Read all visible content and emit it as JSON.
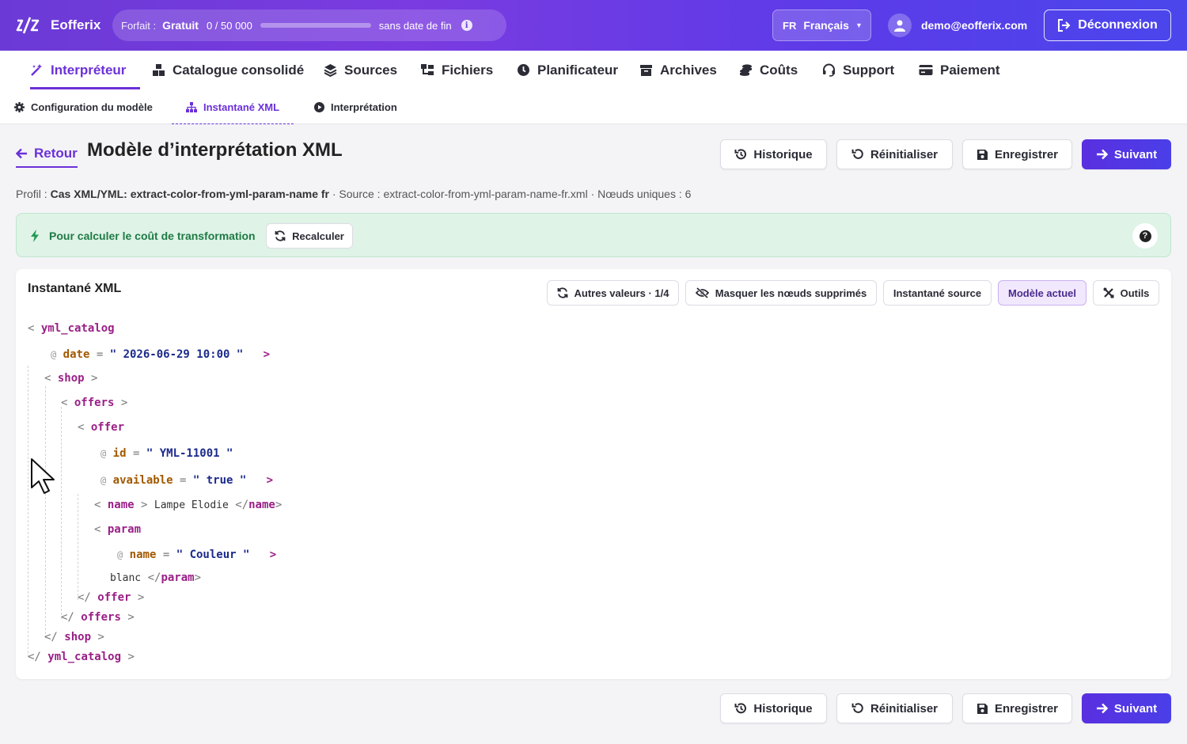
{
  "app": {
    "name": "Eofferix"
  },
  "plan": {
    "label": "Forfait :",
    "tier": "Gratuit",
    "quota": "0  /  50 000",
    "usage_fraction": 0.0,
    "end": "sans date de fin"
  },
  "lang": {
    "code": "FR",
    "name": "Français"
  },
  "user": {
    "email": "demo@eofferix.com"
  },
  "logout_label": "Déconnexion",
  "nav": [
    {
      "label": "Interpréteur",
      "icon": "magic-wand-icon",
      "active": true
    },
    {
      "label": "Catalogue consolidé",
      "icon": "boxes-icon"
    },
    {
      "label": "Sources",
      "icon": "layers-icon"
    },
    {
      "label": "Fichiers",
      "icon": "sitemap-icon"
    },
    {
      "label": "Planificateur",
      "icon": "clock-icon"
    },
    {
      "label": "Archives",
      "icon": "archive-icon"
    },
    {
      "label": "Coûts",
      "icon": "coins-icon"
    },
    {
      "label": "Support",
      "icon": "headset-icon"
    },
    {
      "label": "Paiement",
      "icon": "credit-card-icon"
    }
  ],
  "subnav": [
    {
      "label": "Configuration du modèle",
      "icon": "gear-icon"
    },
    {
      "label": "Instantané XML",
      "icon": "sitemap-icon",
      "active": true
    },
    {
      "label": "Interprétation",
      "icon": "play-circle-icon"
    }
  ],
  "page": {
    "back_label": "Retour",
    "title": "Modèle d’interprétation XML",
    "actions": {
      "history": "Historique",
      "reset": "Réinitialiser",
      "save": "Enregistrer",
      "next": "Suivant"
    }
  },
  "meta": {
    "profile_label": "Profil :",
    "profile": "Cas XML/YML: extract-color-from-yml-param-name fr",
    "source_text": "· Source : extract-color-from-yml-param-name-fr.xml · Nœuds uniques : 6"
  },
  "alert": {
    "text": "Pour calculer le coût de transformation",
    "recalc": "Recalculer",
    "help": "?"
  },
  "snapshot": {
    "title": "Instantané XML",
    "tools": {
      "other_values": "Autres valeurs · 1/4",
      "hide_deleted": "Masquer les nœuds supprimés",
      "source_snapshot": "Instantané source",
      "current_model": "Modèle actuel",
      "tools": "Outils"
    }
  },
  "xml": {
    "root": "yml_catalog",
    "root_attr": {
      "name": "date",
      "value": "2026-06-29 10:00"
    },
    "shop": "shop",
    "offers": "offers",
    "offer": "offer",
    "offer_attrs": [
      {
        "name": "id",
        "value": "YML-11001"
      },
      {
        "name": "available",
        "value": "true"
      }
    ],
    "name_tag": "name",
    "name_text": "Lampe Elodie",
    "param_tag": "param",
    "param_attr": {
      "name": "name",
      "value": "Couleur"
    },
    "param_text": "blanc"
  },
  "colors": {
    "accent": "#6b30d9",
    "primary_button": "#5a2fe0",
    "alert_bg": "#dff3e7",
    "alert_text": "#1f7a45"
  }
}
